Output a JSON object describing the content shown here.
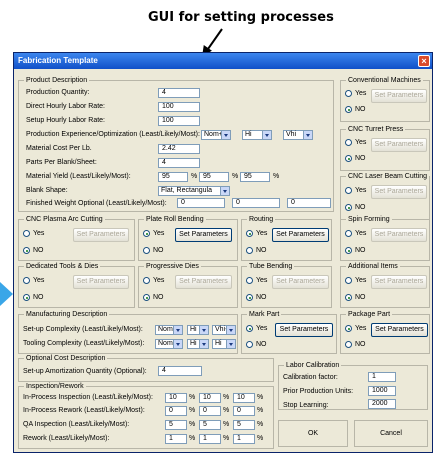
{
  "heading": "GUI for setting processes",
  "window": {
    "title": "Fabrication Template",
    "close_glyph": "×"
  },
  "product": {
    "title": "Product Description",
    "production_quantity": {
      "label": "Production Quantity:",
      "value": "4"
    },
    "direct_labor_rate": {
      "label": "Direct Hourly Labor Rate:",
      "value": "100"
    },
    "setup_labor_rate": {
      "label": "Setup Hourly Labor Rate:",
      "value": "100"
    },
    "production_experience": {
      "label": "Production Experience/Optimization (Least/Likely/Most):",
      "least": "Nom+",
      "likely": "Hi",
      "most": "Vhi"
    },
    "material_cost": {
      "label": "Material Cost Per Lb.",
      "value": "2.42"
    },
    "parts_per_blank": {
      "label": "Parts Per Blank/Sheet:",
      "value": "4"
    },
    "material_yield": {
      "label": "Material Yield (Least/Likely/Most):",
      "least": "95",
      "likely": "95",
      "most": "95",
      "unit": "%"
    },
    "blank_shape": {
      "label": "Blank Shape:",
      "value": "Flat, Rectangula"
    },
    "finished_weight": {
      "label": "Finished Weight Optional (Least/Likely/Most):",
      "least": "0",
      "likely": "0",
      "most": "0"
    }
  },
  "radio_labels": {
    "yes": "Yes",
    "no": "NO"
  },
  "set_parameters_label": "Set Parameters",
  "processes": {
    "conventional_machines": "Conventional Machines",
    "cnc_turret_press": "CNC Turret Press",
    "cnc_laser_beam": "CNC Laser Beam Cutting",
    "cnc_plasma_arc": "CNC Plasma Arc Cutting",
    "plate_roll_bending": "Plate Roll Bending",
    "routing": "Routing",
    "spin_forming": "Spin Forming",
    "dedicated_tools": "Dedicated Tools & Dies",
    "progressive_dies": "Progressive Dies",
    "tube_bending": "Tube Bending",
    "additional_items": "Additional Items",
    "mark_part": "Mark Part",
    "package_part": "Package Part"
  },
  "manufacturing": {
    "title": "Manufacturing Description",
    "setup_complexity": {
      "label": "Set-up Complexity (Least/Likely/Most):",
      "least": "Nom",
      "likely": "Hi",
      "most": "Vhi-"
    },
    "tooling_complexity": {
      "label": "Tooling Complexity (Least/Likely/Most):",
      "least": "Nom",
      "likely": "Hi",
      "most": "Hi"
    }
  },
  "optional_cost": {
    "title": "Optional Cost Description",
    "setup_amortization": {
      "label": "Set-up Amortization Quantity (Optional):",
      "value": "4"
    }
  },
  "inspection": {
    "title": "Inspection/Rework",
    "unit": "%",
    "rows": [
      {
        "label": "In-Process Inspection (Least/Likely/Most):",
        "least": "10",
        "likely": "10",
        "most": "10"
      },
      {
        "label": "In-Process Rework (Least/Likely/Most):",
        "least": "0",
        "likely": "0",
        "most": "0"
      },
      {
        "label": "QA Inspection (Least/Likely/Most):",
        "least": "5",
        "likely": "5",
        "most": "5"
      },
      {
        "label": "Rework (Least/Likely/Most):",
        "least": "1",
        "likely": "1",
        "most": "1"
      }
    ]
  },
  "labor_calibration": {
    "title": "Labor Calibration",
    "calibration_factor": {
      "label": "Calibration factor:",
      "value": "1"
    },
    "prior_units": {
      "label": "Prior Production Units:",
      "value": "1000"
    },
    "stop_learning": {
      "label": "Stop Learning:",
      "value": "2000"
    }
  },
  "buttons": {
    "ok": "OK",
    "cancel": "Cancel"
  },
  "colors": {
    "titlebar": "#1050c8",
    "window_bg": "#ece9d8",
    "side_arrow": "#3aa6e8"
  }
}
